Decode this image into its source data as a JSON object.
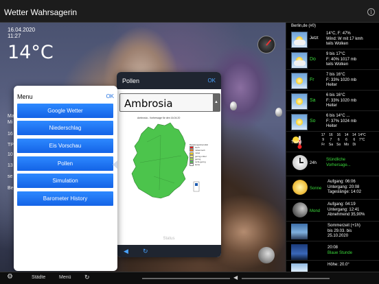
{
  "app": {
    "title": "Wetter Wahrsagerin",
    "info_icon": "info-icon"
  },
  "main": {
    "date": "16.04.2020",
    "time": "11:27",
    "temperature": "14°C",
    "side_texts": [
      "Ma",
      "Mi",
      "16",
      "TP",
      "10",
      "13",
      "se",
      "Be"
    ]
  },
  "pollen": {
    "title": "Pollen",
    "ok": "OK",
    "selected": "Ambrosia",
    "map_caption": "Ambrosia - Vorhersage für den 16.04.20",
    "legend_title": "Belastungsintensität",
    "legend": [
      {
        "label": "hoch",
        "color": "#e21d1d"
      },
      {
        "label": "mittel-hoch",
        "color": "#f07b1c"
      },
      {
        "label": "mittel",
        "color": "#f5d01c"
      },
      {
        "label": "gering-mittel",
        "color": "#f7f07a"
      },
      {
        "label": "gering",
        "color": "#a4e04c"
      },
      {
        "label": "nicht-gering",
        "color": "#4cc44c"
      },
      {
        "label": "keine",
        "color": "#ffffff"
      }
    ],
    "status": "Status"
  },
  "menu": {
    "title": "Menu",
    "ok": "OK",
    "items": [
      "Google Wetter",
      "Niederschlag",
      "Eis Vorschau",
      "Pollen",
      "Simulation",
      "Barometer History"
    ]
  },
  "bottom": {
    "staedte": "Städte",
    "menue": "Menü"
  },
  "forecast": {
    "location": "Berlin,de (#0)",
    "days": [
      {
        "day": "Jetzt",
        "lines": [
          "14°C, F: 47%",
          "Wind: W mit 17 kmh",
          "teils Wolken"
        ]
      },
      {
        "day": "Do",
        "lines": [
          "9 bis 17°C",
          "F: 40% 1017 mb",
          "teils Wolken"
        ]
      },
      {
        "day": "Fr",
        "lines": [
          "7 bis 16°C",
          "F: 33% 1020 mb",
          "Heiter"
        ]
      },
      {
        "day": "Sa",
        "lines": [
          "6 bis 16°C",
          "F: 33% 1020 mb",
          "Heiter"
        ]
      },
      {
        "day": "So",
        "lines": [
          "6 bis 14°C ...",
          "F: 37% 1024 mb",
          "Heiter"
        ]
      }
    ],
    "trend": {
      "label": "Trend",
      "highs": [
        "17",
        "16",
        "16",
        "14",
        "14",
        "14°C"
      ],
      "lows": [
        "9",
        "7",
        "6",
        "6",
        "6",
        "7°C"
      ],
      "days": [
        "Fr",
        "Sa",
        "So",
        "Mo",
        "Di",
        ""
      ]
    },
    "hourly": {
      "label": "24h",
      "lines": [
        "Stündliche",
        "Vorhersage..."
      ]
    },
    "sun": {
      "label": "Sonne",
      "lines": [
        "Aufgang: 06:06",
        "Untergang: 20:08",
        "Tageslänge: 14:02"
      ]
    },
    "moon": {
      "label": "Mond",
      "lines": [
        "Aufgang: 04:19",
        "Untergang: 12:41",
        "Abnehmend 35,90%"
      ]
    },
    "summer": {
      "lines": [
        "Sommerzeit (+1h)",
        "bis 29.03. bis",
        "25.10.2020"
      ]
    },
    "blue": {
      "lines": [
        "20:08",
        "Blaue Stunde"
      ]
    },
    "height": {
      "lines": [
        "Höhe: 20.0°"
      ]
    }
  }
}
